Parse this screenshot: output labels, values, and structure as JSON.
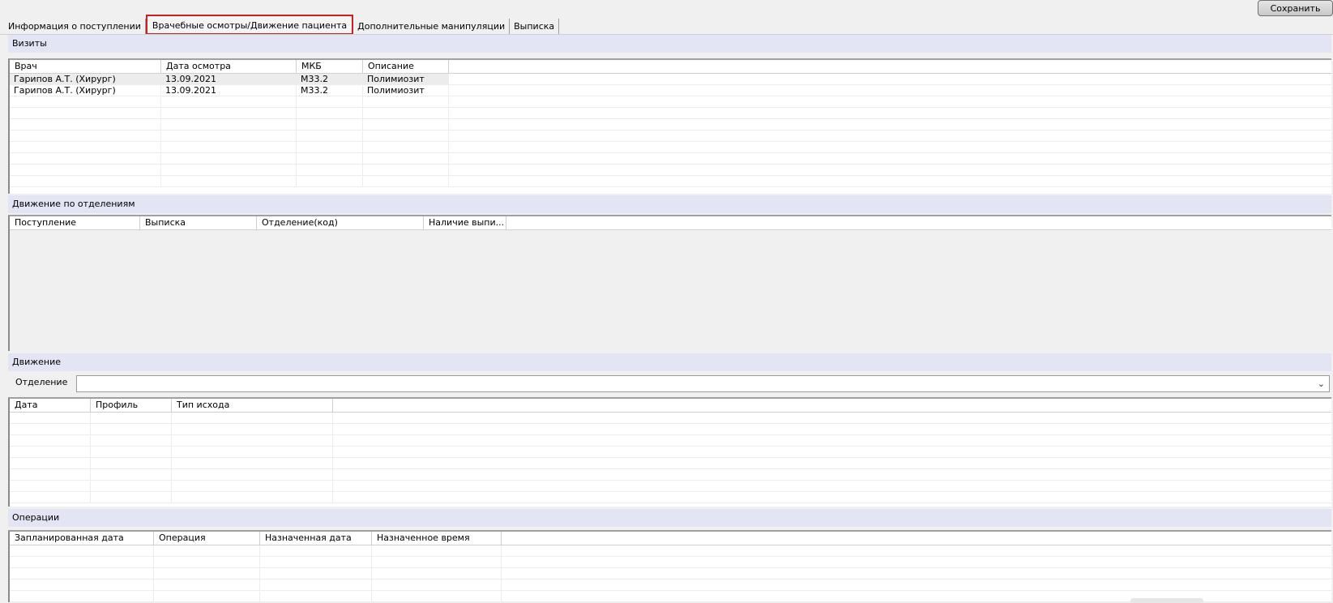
{
  "toolbar": {
    "save_label": "Сохранить"
  },
  "tabs": [
    {
      "label": "Информация о поступлении"
    },
    {
      "label": "Врачебные осмотры/Движение пациента"
    },
    {
      "label": "Дополнительные манипуляции"
    },
    {
      "label": "Выписка"
    }
  ],
  "visits": {
    "title": "Визиты",
    "columns": [
      "Врач",
      "Дата осмотра",
      "МКБ",
      "Описание"
    ],
    "rows": [
      [
        "Гарипов А.Т. (Хирург)",
        "13.09.2021",
        "M33.2",
        "Полимиозит"
      ],
      [
        "Гарипов А.Т. (Хирург)",
        "13.09.2021",
        "M33.2",
        "Полимиозит"
      ]
    ]
  },
  "dept_movement": {
    "title": "Движение по отделениям",
    "columns": [
      "Поступление",
      "Выписка",
      "Отделение(код)",
      "Наличие выпи..."
    ]
  },
  "movement": {
    "title": "Движение",
    "department_label": "Отделение",
    "department_value": "",
    "columns": [
      "Дата",
      "Профиль",
      "Тип исхода"
    ]
  },
  "operations": {
    "title": "Операции",
    "columns": [
      "Запланированная дата",
      "Операция",
      "Назначенная дата",
      "Назначенное время"
    ]
  }
}
